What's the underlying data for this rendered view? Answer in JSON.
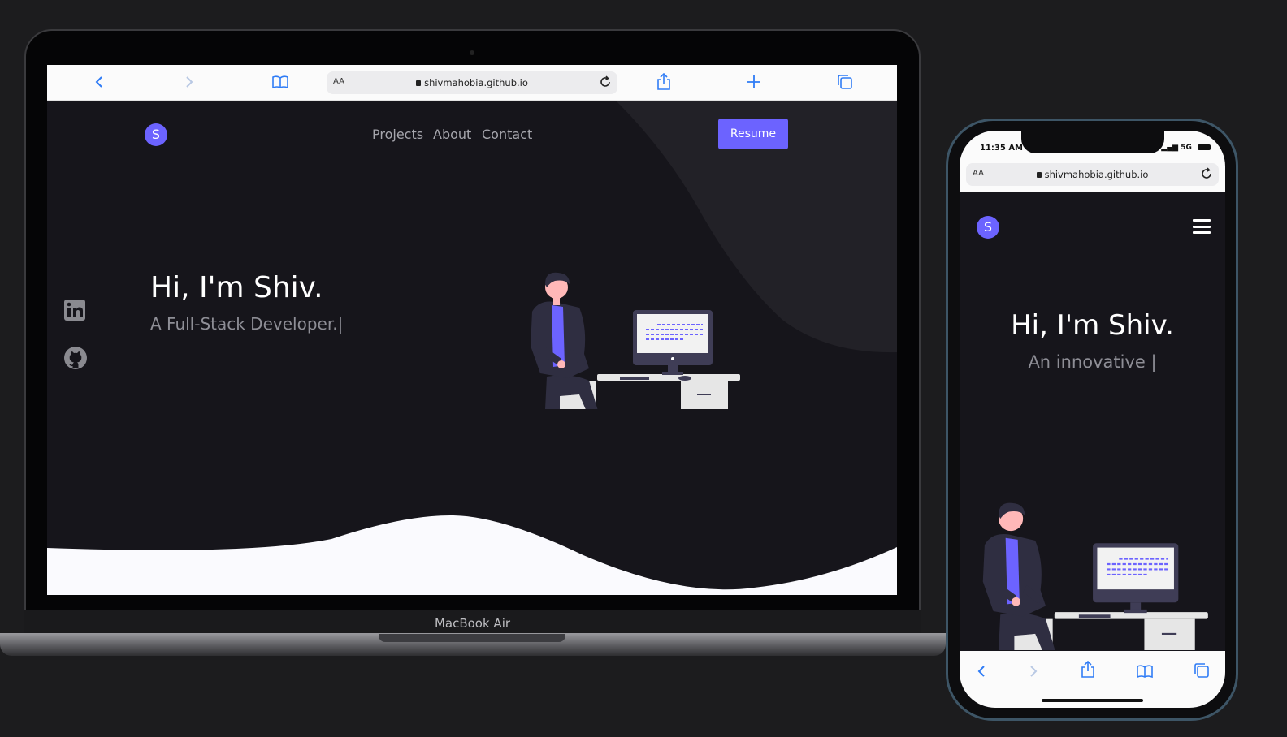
{
  "laptop": {
    "browser": {
      "aa_label": "AA",
      "url": "shivmahobia.github.io"
    },
    "logo_letter": "S",
    "nav": {
      "links": [
        "Projects",
        "About",
        "Contact"
      ],
      "resume_label": "Resume"
    },
    "hero": {
      "title": "Hi, I'm Shiv.",
      "subtitle": "A Full-Stack Developer.|"
    },
    "social": [
      "linkedin-icon",
      "github-icon"
    ],
    "device_label": "MacBook Air"
  },
  "phone": {
    "status": {
      "time": "11:35 AM",
      "network": "5G"
    },
    "browser": {
      "aa_label": "AA",
      "url": "shivmahobia.github.io"
    },
    "logo_letter": "S",
    "hero": {
      "title": "Hi, I'm Shiv.",
      "subtitle": "An innovative |"
    }
  },
  "colors": {
    "accent": "#6c63ff",
    "page_bg": "#16151b",
    "browser_blue": "#2f7cf6"
  }
}
